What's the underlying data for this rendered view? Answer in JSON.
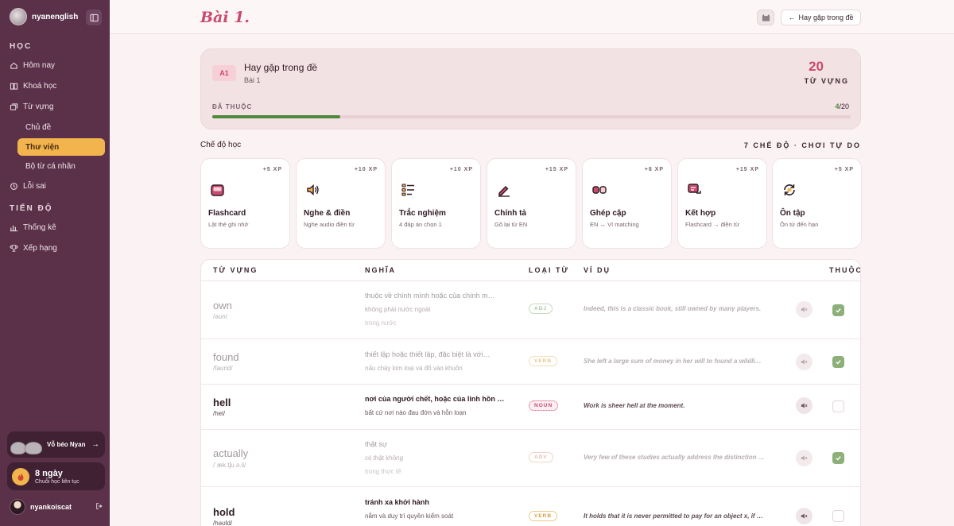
{
  "sidebar": {
    "brand": "nyanenglish",
    "section_learn": "HỌC",
    "items": [
      {
        "label": "Hôm nay"
      },
      {
        "label": "Khoá học"
      },
      {
        "label": "Từ vựng"
      }
    ],
    "sub_items": [
      {
        "label": "Chủ đề"
      },
      {
        "label": "Thư viện"
      },
      {
        "label": "Bộ từ cá nhân"
      }
    ],
    "mistakes": "Lỗi sai",
    "section_progress": "TIẾN ĐỘ",
    "stats": "Thống kê",
    "ranking": "Xếp hạng",
    "promo": "Vỗ béo Nyan",
    "streak_days": "8 ngày",
    "streak_sub": "Chuỗi học liên tục",
    "user": "nyankoiscat"
  },
  "header": {
    "title": "Bài 1.",
    "back_label": "Hay gặp trong đề"
  },
  "summary": {
    "level": "A1",
    "name": "Hay gặp trong đề",
    "sub": "Bài 1",
    "count": "20",
    "count_label": "TỪ VỰNG",
    "known_label": "ĐÃ THUỘC",
    "known": "4",
    "total": "/20",
    "progress": 0.2
  },
  "modes": {
    "title": "Chế độ học",
    "meta": "7 CHẾ ĐỘ · CHƠI TỰ DO",
    "items": [
      {
        "xp": "+5 XP",
        "name": "Flashcard",
        "desc": "Lật thẻ ghi nhớ",
        "icon": "flashcard-icon"
      },
      {
        "xp": "+10 XP",
        "name": "Nghe & điền",
        "desc": "Nghe audio điền từ",
        "icon": "speaker-icon"
      },
      {
        "xp": "+10 XP",
        "name": "Trắc nghiệm",
        "desc": "4 đáp án chọn 1",
        "icon": "checklist-icon"
      },
      {
        "xp": "+15 XP",
        "name": "Chính tả",
        "desc": "Gõ lại từ EN",
        "icon": "pencil-icon"
      },
      {
        "xp": "+8 XP",
        "name": "Ghép cặp",
        "desc": "EN ↔ VI matching",
        "icon": "link-icon"
      },
      {
        "xp": "+15 XP",
        "name": "Kết hợp",
        "desc": "Flashcard → điền từ",
        "icon": "combo-icon"
      },
      {
        "xp": "+5 XP",
        "name": "Ôn tập",
        "desc": "Ôn từ đến hạn",
        "icon": "review-icon"
      }
    ]
  },
  "table": {
    "headers": [
      "TỪ VỰNG",
      "NGHĨA",
      "LOẠI TỪ",
      "VÍ DỤ",
      "THUỘC"
    ],
    "rows": [
      {
        "word": "own",
        "pron": "/əʊn/",
        "m1": "thuộc về chính mình hoặc của chính m…",
        "m2": "không phải nước ngoài",
        "m3": "trong nước",
        "pos": "ADJ",
        "ex": "Indeed, this is a classic book, still owned by many players.",
        "known": true
      },
      {
        "word": "found",
        "pron": "/faʊnd/",
        "m1": "thiết lập hoặc thiết lập, đặc biệt là với…",
        "m2": "nấu chảy kim loại và đổ vào khuôn",
        "m3": "",
        "pos": "VERB",
        "ex": "She left a large sum of money in her will to found a wildli…",
        "known": true
      },
      {
        "word": "hell",
        "pron": "/hel/",
        "m1": "nơi của người chết, hoặc của linh hồn …",
        "m2": "bất cứ nơi nào đau đớn và hỗn loạn",
        "m3": "",
        "pos": "NOUN",
        "ex": "Work is sheer hell at the moment.",
        "known": false
      },
      {
        "word": "actually",
        "pron": "/ˈæk.tʃu.ə.li/",
        "m1": "thật sự",
        "m2": "có thật không",
        "m3": "trong thực tế",
        "pos": "ADV",
        "ex": "Very few of these studies actually address the distinction …",
        "known": true
      },
      {
        "word": "hold",
        "pron": "/həʊld/",
        "m1": "tránh xa khởi hành",
        "m2": "nắm và duy trì quyền kiểm soát",
        "m3": "",
        "pos": "VERB",
        "ex": "It holds that it is never permitted to pay for an object x, if …",
        "known": false
      }
    ]
  }
}
